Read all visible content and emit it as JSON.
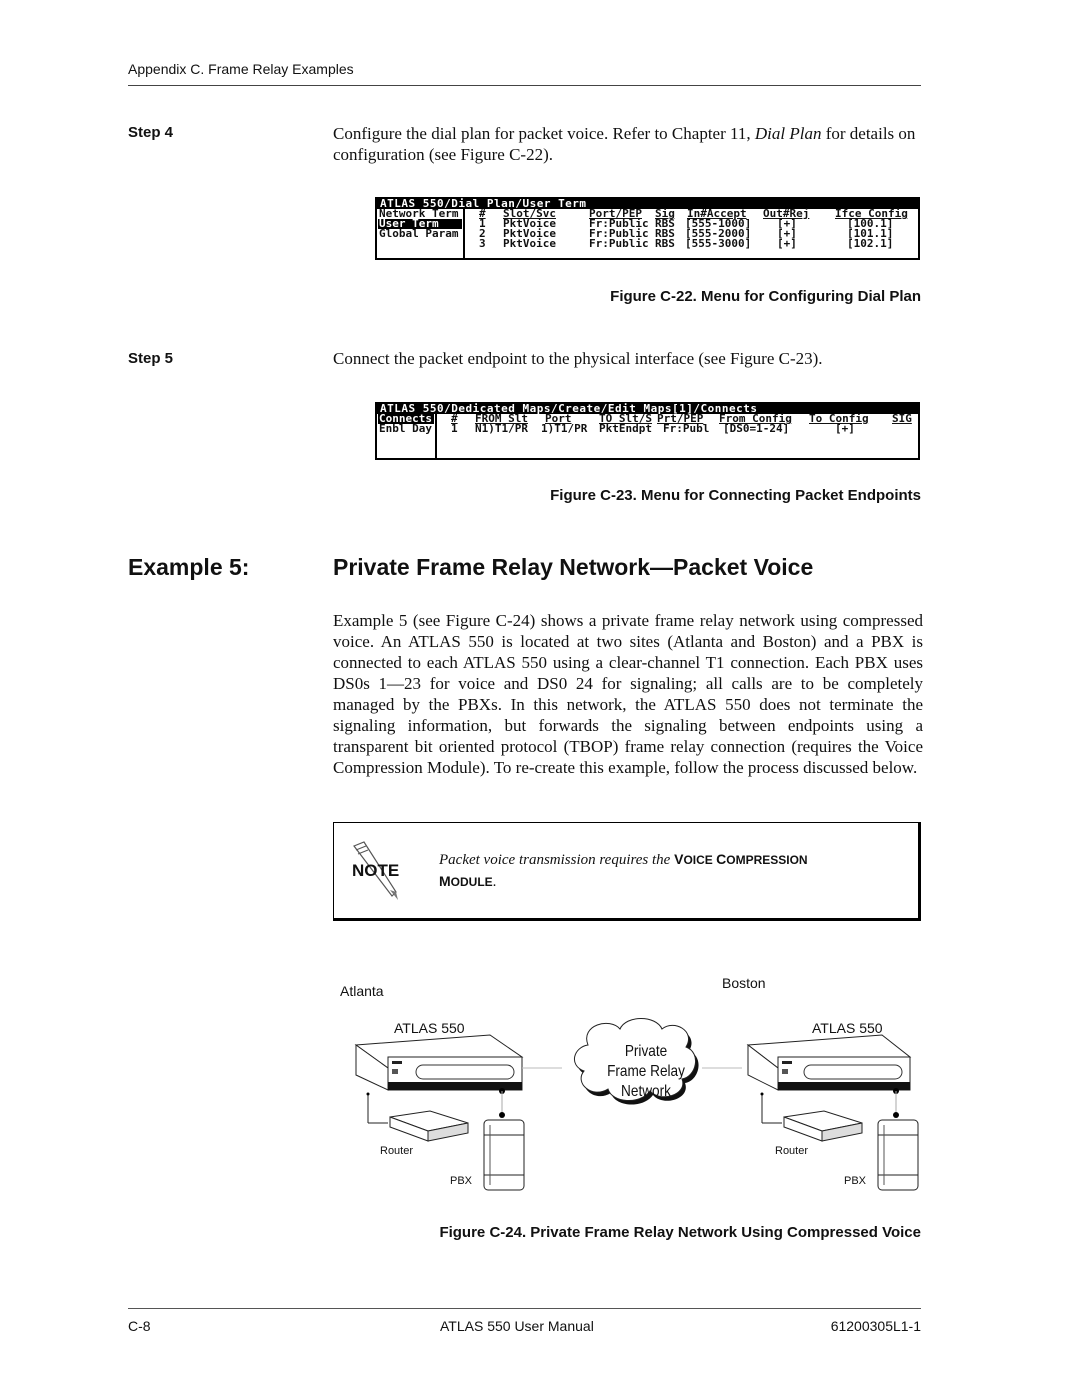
{
  "header": {
    "running_head": "Appendix C.  Frame Relay Examples"
  },
  "step4": {
    "label": "Step 4",
    "text_before_ref": "Configure the dial plan for packet voice. Refer to Chapter 11, ",
    "ref_italic": "Dial Plan",
    "text_after_ref": " for details on configuration (see Figure C-22)."
  },
  "figure22": {
    "caption": "Figure C-22. Menu for Configuring Dial Plan",
    "title_bar": "ATLAS 550/Dial Plan/User Term",
    "menu": [
      "Network Term",
      "User Term",
      "Global Param"
    ],
    "selected_menu": "User Term",
    "columns": [
      "#",
      "Slot/Svc",
      "Port/PEP",
      "Sig",
      "In#Accept",
      "Out#Rej",
      "Ifce Config"
    ],
    "rows": [
      [
        "1",
        "PktVoice",
        "Fr:Public",
        "RBS",
        "[555-1000]",
        "[+]",
        "[100.1]"
      ],
      [
        "2",
        "PktVoice",
        "Fr:Public",
        "RBS",
        "[555-2000]",
        "[+]",
        "[101.1]"
      ],
      [
        "3",
        "PktVoice",
        "Fr:Public",
        "RBS",
        "[555-3000]",
        "[+]",
        "[102.1]"
      ]
    ]
  },
  "step5": {
    "label": "Step 5",
    "text": "Connect the packet endpoint to the physical interface (see Figure C-23)."
  },
  "figure23": {
    "caption": "Figure C-23. Menu for Connecting Packet Endpoints",
    "title_bar": "ATLAS 550/Dedicated Maps/Create/Edit Maps[1]/Connects",
    "menu": [
      "Connects",
      "Enbl Day"
    ],
    "selected_menu": "Connects",
    "columns": [
      "#",
      "FROM Slt",
      "Port",
      "TO Slt/S",
      "Prt/PEP",
      "From Config",
      "To Config",
      "SIG"
    ],
    "rows": [
      [
        "1",
        "N1)T1/PR",
        "1)T1/PR",
        "PktEndpt",
        "Fr:Publ",
        "[DS0=1-24]",
        "[+]",
        ""
      ]
    ]
  },
  "example": {
    "label": "Example 5:",
    "title": "Private Frame Relay Network—Packet Voice",
    "paragraph": "Example 5 (see Figure C-24) shows a private frame relay network using compressed voice. An ATLAS 550 is located at two sites (Atlanta and Boston) and a PBX is connected to each ATLAS 550 using a clear-channel T1 connection. Each PBX uses DS0s 1—23 for voice and DS0 24 for signaling; all calls are to be completely managed by the PBXs. In this network, the ATLAS 550 does not terminate the signaling information, but forwards the signaling between endpoints using a transparent bit oriented protocol (TBOP) frame relay connection (requires the Voice Compression Module). To re-create this example, follow the process discussed below."
  },
  "note": {
    "icon": "note-pencil-icon",
    "icon_text": "NOTE",
    "text_italic": "Packet voice transmission requires the ",
    "sc1_first": "V",
    "sc1_rest": "OICE",
    "sc2_first": "C",
    "sc2_rest": "OMPRESSION",
    "sc3_first": "M",
    "sc3_rest": "ODULE",
    "period": "."
  },
  "figure24": {
    "caption": "Figure C-24. Private Frame Relay Network Using Compressed Voice",
    "left_site": {
      "name": "Atlanta",
      "device": "ATLAS 550",
      "router": "Router",
      "pbx": "PBX"
    },
    "right_site": {
      "name": "Boston",
      "device": "ATLAS 550",
      "router": "Router",
      "pbx": "PBX"
    },
    "cloud": [
      "Private",
      "Frame Relay",
      "Network"
    ]
  },
  "footer": {
    "page": "C-8",
    "title": "ATLAS 550 User Manual",
    "doc_number": "61200305L1-1"
  }
}
